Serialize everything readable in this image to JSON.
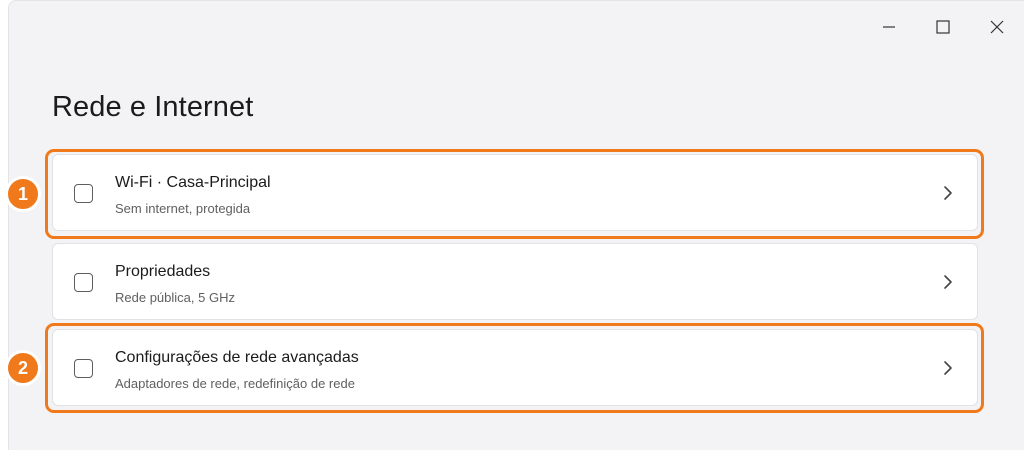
{
  "window": {
    "controls": {
      "minimize_icon": "minimize-icon",
      "maximize_icon": "maximize-icon",
      "close_icon": "close-icon"
    }
  },
  "page": {
    "title": "Rede e Internet"
  },
  "settings": [
    {
      "title": "Wi-Fi · Casa-Principal",
      "description": "Sem internet, protegida",
      "icon": "checkbox-icon",
      "chevron": "chevron-right-icon",
      "callout": "1"
    },
    {
      "title": "Propriedades",
      "description": "Rede pública, 5 GHz",
      "icon": "checkbox-icon",
      "chevron": "chevron-right-icon",
      "callout": ""
    },
    {
      "title": "Configurações de rede avançadas",
      "description": "Adaptadores de rede, redefinição de rede",
      "icon": "checkbox-icon",
      "chevron": "chevron-right-icon",
      "callout": "2"
    }
  ],
  "colors": {
    "accent": "#f07a1b",
    "window_background": "#f3f3f5",
    "card_background": "#ffffff",
    "text_primary": "#1b1b1b",
    "text_secondary": "#606060"
  }
}
